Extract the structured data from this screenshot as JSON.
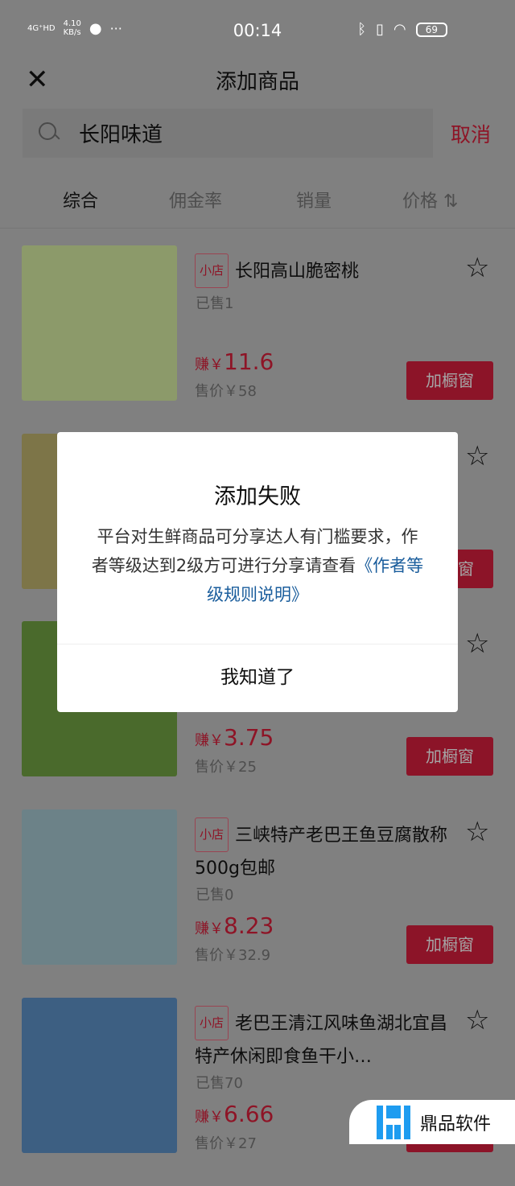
{
  "status_bar": {
    "network": "4G⁺HD",
    "speed": "4.10",
    "speed_unit": "KB/s",
    "more": "···",
    "time": "00:14",
    "battery": "69"
  },
  "header": {
    "title": "添加商品"
  },
  "search": {
    "value": "长阳味道",
    "cancel": "取消"
  },
  "tabs": [
    {
      "label": "综合"
    },
    {
      "label": "佣金率"
    },
    {
      "label": "销量"
    },
    {
      "label": "价格 ⇅"
    }
  ],
  "products": [
    {
      "badge": "小店",
      "name": "长阳高山脆密桃",
      "sold": "已售1",
      "earn_prefix": "赚￥",
      "earn": "11.6",
      "price": "售价￥58",
      "button": "加橱窗",
      "image_color": "#8c9a6a"
    },
    {
      "button": "加橱窗",
      "image_color": "#7d7548"
    },
    {
      "earn_prefix": "赚￥",
      "earn": "3.75",
      "price": "售价￥25",
      "button": "加橱窗",
      "image_color": "#4a6a2c"
    },
    {
      "badge": "小店",
      "name": "三峡特产老巴王鱼豆腐散称500g包邮",
      "sold": "已售0",
      "earn_prefix": "赚￥",
      "earn": "8.23",
      "price": "售价￥32.9",
      "button": "加橱窗",
      "image_color": "#6c8288"
    },
    {
      "badge": "小店",
      "name": "老巴王清江风味鱼湖北宜昌特产休闲即食鱼干小…",
      "sold": "已售70",
      "earn_prefix": "赚￥",
      "earn": "6.66",
      "price": "售价￥27",
      "button": "加橱窗",
      "image_color": "#3d5f82"
    }
  ],
  "dialog": {
    "title": "添加失败",
    "body": "平台对生鲜商品可分享达人有门槛要求，作者等级达到2级方可进行分享请查看",
    "link": "《作者等级规则说明》",
    "ok": "我知道了"
  },
  "watermark": {
    "text": "鼎品软件"
  },
  "colors": {
    "accent": "#fe2c55",
    "link": "#1a5d9c",
    "watermark": "#1e9cf0"
  }
}
